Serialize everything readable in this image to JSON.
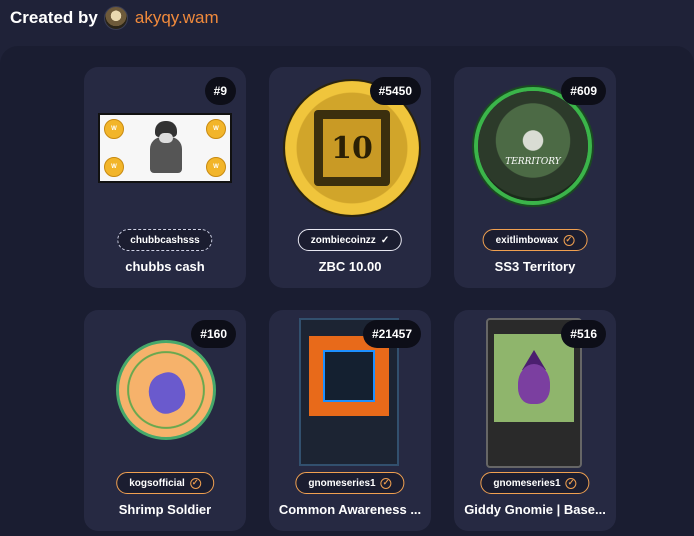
{
  "header": {
    "created_label": "Created by",
    "creator_name": "akyqy.wam"
  },
  "cards": [
    {
      "badge": "#9",
      "collection": "chubbcashsss",
      "verified": false,
      "title": "chubbs cash"
    },
    {
      "badge": "#5450",
      "collection": "zombiecoinzz",
      "verified": true,
      "title": "ZBC 10.00",
      "coin_number": "10"
    },
    {
      "badge": "#609",
      "collection": "exitlimbowax",
      "verified": true,
      "title": "SS3 Territory",
      "art_text": "TERRITORY"
    },
    {
      "badge": "#160",
      "collection": "kogsofficial",
      "verified": true,
      "title": "Shrimp Soldier"
    },
    {
      "badge": "#21457",
      "collection": "gnomeseries1",
      "verified": true,
      "title": "Common Awareness ..."
    },
    {
      "badge": "#516",
      "collection": "gnomeseries1",
      "verified": true,
      "title": "Giddy Gnomie | Base..."
    }
  ],
  "colors": {
    "background": "#1f2238",
    "card": "#262942",
    "accent": "#f08a3c"
  }
}
